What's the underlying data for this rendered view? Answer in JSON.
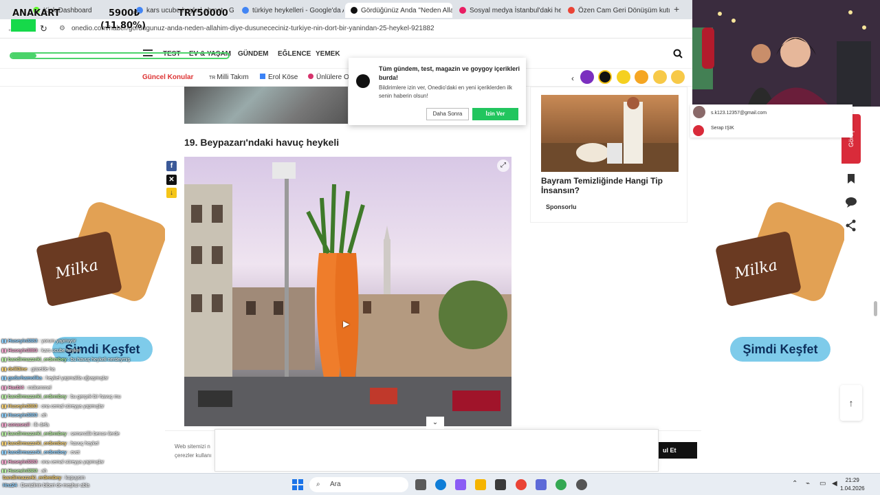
{
  "browser": {
    "tabs": [
      {
        "label": "Kick Dashboard",
        "prefix": "Stream"
      },
      {
        "label": "kars ucube heykel ahmet - Go"
      },
      {
        "label": "türkiye heykelleri - Google'da A"
      },
      {
        "label": "Gördüğünüz Anda \"Neden Allah",
        "active": true
      },
      {
        "label": "Sosyal medya İstanbul'daki hey"
      },
      {
        "label": "Özen Cam Geri Dönüşüm kutu"
      }
    ],
    "new_tab": "+",
    "url": "onedio.com/haber/gordugunuz-anda-neden-allahim-diye-dusunececiniz-turkiye-nin-dort-bir-yanindan-25-heykel-921882"
  },
  "ticker": {
    "name": "ANAKART",
    "value": "5900₺",
    "percent": "(11.80%)",
    "target": "TRY50000",
    "progress": 0.118
  },
  "site": {
    "nav": [
      "TEST",
      "EV & YAŞAM",
      "GÜNDEM",
      "EĞLENCE",
      "YEMEK"
    ],
    "topics_label": "Güncel Konular",
    "topics": [
      "Milli Takım",
      "Erol Köse",
      "Ünlülere O"
    ]
  },
  "notification": {
    "title": "Tüm gündem, test, magazin ve goygoy içerikleri burda!",
    "body": "Bildirimlere izin ver, Onedio'daki en yeni içeriklerden ilk senin haberin olsun!",
    "later": "Daha Sonra",
    "allow": "İzin Ver"
  },
  "article": {
    "heading": "19. Beypazarı'ndaki havuç heykeli"
  },
  "sidebar": {
    "title": "Bayram Temizliğinde Hangi Tip İnsansın?",
    "sponsor": "Sponsorlu"
  },
  "ads": {
    "cta": "Şimdi Keşfet"
  },
  "chat_snippet": {
    "line1": "s.k123.12357@gmail.com",
    "line2": "Serap IŞIK"
  },
  "floating": {
    "red_tab": "Görüş"
  },
  "chat": [
    {
      "user": "Huseyin3883",
      "msg": "yorum yapmıyor"
    },
    {
      "user": "Huseyin3883",
      "msg": "kars ucube heykel"
    },
    {
      "user": "bandirmazzeki_erdembey",
      "msg": "bu havuç heykeli nerdeymiş"
    },
    {
      "user": "delil3ine",
      "msg": "güzelde ha"
    },
    {
      "user": "gadarhamolika",
      "msg": "heykel yapmakla uğraşmışlar"
    },
    {
      "user": "Hasbi4",
      "msg": "mükemmel"
    },
    {
      "user": "bandirmazzeki_erdembey",
      "msg": "bu gerçek bir havuç mu"
    },
    {
      "user": "Huseyin3883",
      "msg": "ona cemal süreyya yapmışlar"
    },
    {
      "user": "Huseyin3883",
      "msg": "ah"
    },
    {
      "user": "sonasezil",
      "msg": "ilk defa"
    },
    {
      "user": "bandirmazzeki_erdembey",
      "msg": "semercilik bence ilerde"
    },
    {
      "user": "bandirmazzeki_erdembey",
      "msg": "havuç heykel"
    },
    {
      "user": "bandirmazzeki_erdembey",
      "msg": "evet"
    },
    {
      "user": "Huseyin3883",
      "msg": "ona cemal süreyya yapmışlar"
    },
    {
      "user": "Huseyin3883",
      "msg": "ah"
    }
  ],
  "chat_bottom": [
    {
      "user": "bandirmazzeki_erdembey",
      "msg": "kopuyom"
    },
    {
      "user": "Hnz24",
      "msg": "Denizlinin biberi de meşhur abla"
    }
  ],
  "cookie": {
    "text": "Web sitemizi n çerezler kullanı",
    "accept": "ul Et"
  },
  "taskbar": {
    "search": "Ara",
    "time": "21:29",
    "date": "1.04.2026"
  },
  "colors": {
    "accent_red": "#d92b3a",
    "allow_green": "#22c55e",
    "cta_blue": "#7ecbea",
    "ticker_green": "#16d94a"
  }
}
